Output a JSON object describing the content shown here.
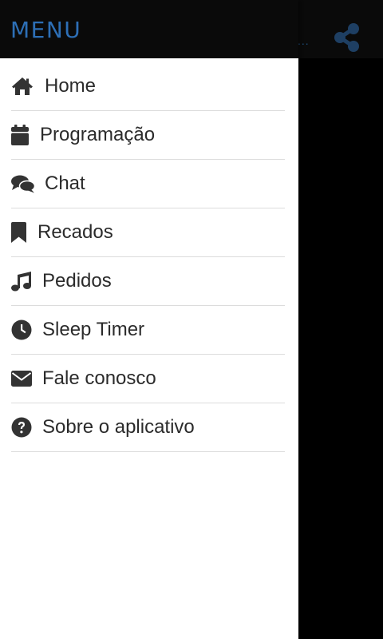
{
  "drawer": {
    "title": "MENU",
    "items": [
      {
        "label": "Home",
        "icon": "home-icon"
      },
      {
        "label": "Programação",
        "icon": "calendar-icon"
      },
      {
        "label": "Chat",
        "icon": "chat-bubbles-icon"
      },
      {
        "label": "Recados",
        "icon": "bookmark-icon"
      },
      {
        "label": "Pedidos",
        "icon": "music-note-icon"
      },
      {
        "label": "Sleep Timer",
        "icon": "clock-icon"
      },
      {
        "label": "Fale conosco",
        "icon": "envelope-icon"
      },
      {
        "label": "Sobre o aplicativo",
        "icon": "question-circle-icon"
      }
    ]
  },
  "background_app": {
    "overflow_glyph": "...",
    "share_icon": "share-icon"
  },
  "colors": {
    "header_bg": "#0a0a0a",
    "title": "#2d6fb6",
    "drawer_bg": "#ffffff",
    "icon": "#333333",
    "divider": "#dcdcdc",
    "share_icon": "#1e3f63"
  }
}
